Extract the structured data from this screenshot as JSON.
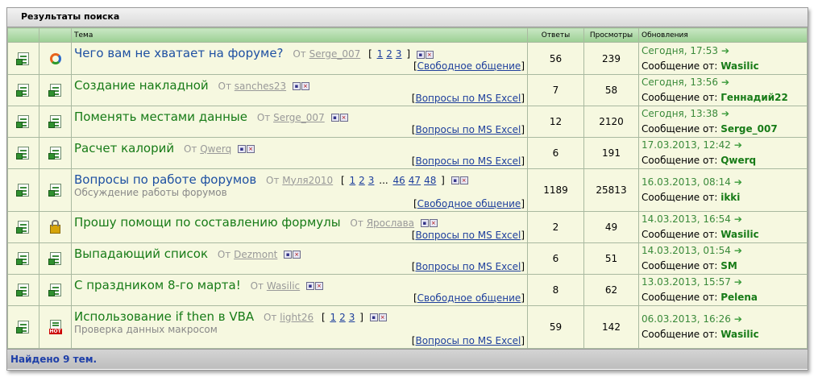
{
  "window": {
    "title": "Результаты поиска"
  },
  "columns": {
    "topic": "Тема",
    "replies": "Ответы",
    "views": "Просмотры",
    "updates": "Обновления"
  },
  "from_label": "От",
  "by_label": "Сообщение от:",
  "topics": [
    {
      "title": "Чего вам не хватает на форуме?",
      "color": "blue",
      "author": "Serge_007",
      "pages": [
        "1",
        "2",
        "3"
      ],
      "forum": "Свободное общение",
      "replies": "56",
      "views": "239",
      "date": "Сегодня, 17:53",
      "last_by": "Wasilic",
      "icon2": "chart-icon"
    },
    {
      "title": "Создание накладной",
      "color": "green",
      "author": "sanches23",
      "forum": "Вопросы по MS Excel",
      "replies": "7",
      "views": "58",
      "date": "Сегодня, 13:56",
      "last_by": "Геннадий22",
      "icon2": "doc-icon"
    },
    {
      "title": "Поменять местами данные",
      "color": "green",
      "author": "Serge_007",
      "forum": "Вопросы по MS Excel",
      "replies": "12",
      "views": "2120",
      "date": "Сегодня, 13:38",
      "last_by": "Serge_007",
      "icon2": "doc-icon"
    },
    {
      "title": "Расчет калорий",
      "color": "green",
      "author": "Qwerq",
      "forum": "Вопросы по MS Excel",
      "replies": "6",
      "views": "191",
      "date": "17.03.2013, 12:42",
      "last_by": "Qwerq",
      "icon2": "doc-icon"
    },
    {
      "title": "Вопросы по работе форумов",
      "color": "blue",
      "author": "Муля2010",
      "pages": [
        "1",
        "2",
        "3"
      ],
      "pages_more": [
        "46",
        "47",
        "48"
      ],
      "desc": "Обсуждение работы форумов",
      "forum": "Свободное общение",
      "replies": "1189",
      "views": "25813",
      "date": "16.03.2013, 08:14",
      "last_by": "ikki",
      "icon2": "doc-icon"
    },
    {
      "title": "Прошу помощи по составлению формулы",
      "color": "green",
      "author": "Ярослава",
      "forum": "Вопросы по MS Excel",
      "replies": "2",
      "views": "49",
      "date": "14.03.2013, 16:54",
      "last_by": "Wasilic",
      "icon2": "lock-icon"
    },
    {
      "title": "Выпадающий список",
      "color": "green",
      "author": "Dezmont",
      "forum": "Вопросы по MS Excel",
      "replies": "6",
      "views": "51",
      "date": "14.03.2013, 01:54",
      "last_by": "SM",
      "icon2": "doc-icon"
    },
    {
      "title": "С праздником 8-го марта!",
      "color": "green",
      "author": "Wasilic",
      "forum": "Свободное общение",
      "replies": "8",
      "views": "62",
      "date": "13.03.2013, 15:57",
      "last_by": "Pelena",
      "icon2": "doc-icon"
    },
    {
      "title": "Использование if then в VBA",
      "color": "green",
      "author": "light26",
      "pages": [
        "1",
        "2",
        "3"
      ],
      "desc": "Проверка данных макросом",
      "forum": "Вопросы по MS Excel",
      "replies": "59",
      "views": "142",
      "date": "06.03.2013, 16:26",
      "last_by": "Wasilic",
      "icon2": "hot-icon"
    }
  ],
  "footer": {
    "text": "Найдено 9 тем."
  },
  "colors": {
    "header_green": "#9ccf94",
    "row_bg": "#f6f8e0",
    "link_blue": "#1e50a2",
    "link_green": "#177b17"
  }
}
